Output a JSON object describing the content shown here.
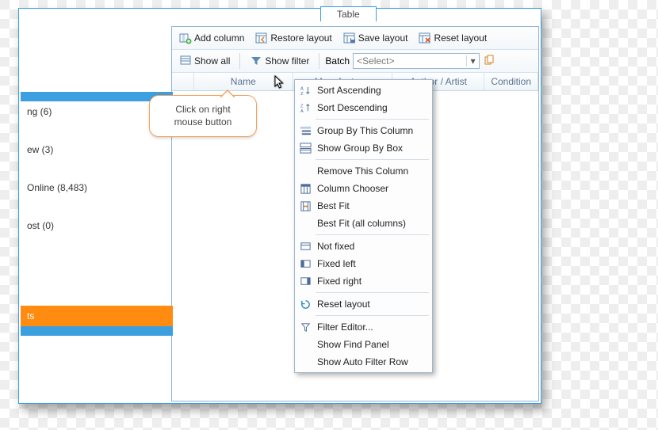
{
  "tab": {
    "label": "Table"
  },
  "toolbar1": {
    "add_column": "Add column",
    "restore_layout": "Restore layout",
    "save_layout": "Save layout",
    "reset_layout": "Reset layout"
  },
  "toolbar2": {
    "show_all": "Show all",
    "show_filter": "Show filter",
    "batch_label": "Batch",
    "batch_select": "<Select>"
  },
  "columns": {
    "name": "Name",
    "manufacturer": "Manufacturer",
    "author_artist": "Author / Artist",
    "condition": "Condition"
  },
  "sidebar": [
    {
      "label": "",
      "cls": "sel"
    },
    {
      "label": "ng  (6)",
      "cls": ""
    },
    {
      "label": "",
      "cls": "blank"
    },
    {
      "label": "ew  (3)",
      "cls": ""
    },
    {
      "label": "",
      "cls": "blank"
    },
    {
      "label": "Online  (8,483)",
      "cls": ""
    },
    {
      "label": "",
      "cls": "blank"
    },
    {
      "label": "ost  (0)",
      "cls": ""
    },
    {
      "label": "",
      "cls": "blank"
    },
    {
      "label": "",
      "cls": "blank"
    },
    {
      "label": "",
      "cls": "blank"
    },
    {
      "label": "",
      "cls": "blank"
    },
    {
      "label": "ts",
      "cls": "orange"
    },
    {
      "label": "",
      "cls": "sel"
    }
  ],
  "callout": {
    "line1": "Click on right",
    "line2": "mouse button"
  },
  "context_menu": [
    {
      "icon": "sort-asc",
      "label": "Sort Ascending"
    },
    {
      "icon": "sort-desc",
      "label": "Sort Descending"
    },
    {
      "sep": true
    },
    {
      "icon": "group",
      "label": "Group By This Column"
    },
    {
      "icon": "groupbox",
      "label": "Show Group By Box"
    },
    {
      "sep": true
    },
    {
      "icon": "",
      "label": "Remove This Column"
    },
    {
      "icon": "chooser",
      "label": "Column Chooser"
    },
    {
      "icon": "bestfit",
      "label": "Best Fit"
    },
    {
      "icon": "",
      "label": "Best Fit (all columns)"
    },
    {
      "sep": true
    },
    {
      "icon": "pin",
      "label": "Not fixed"
    },
    {
      "icon": "pin-left",
      "label": "Fixed left"
    },
    {
      "icon": "pin-right",
      "label": "Fixed right"
    },
    {
      "sep": true
    },
    {
      "icon": "reset",
      "label": "Reset layout"
    },
    {
      "sep": true
    },
    {
      "icon": "filter",
      "label": "Filter Editor..."
    },
    {
      "icon": "",
      "label": "Show Find Panel"
    },
    {
      "icon": "",
      "label": "Show Auto Filter Row"
    }
  ]
}
